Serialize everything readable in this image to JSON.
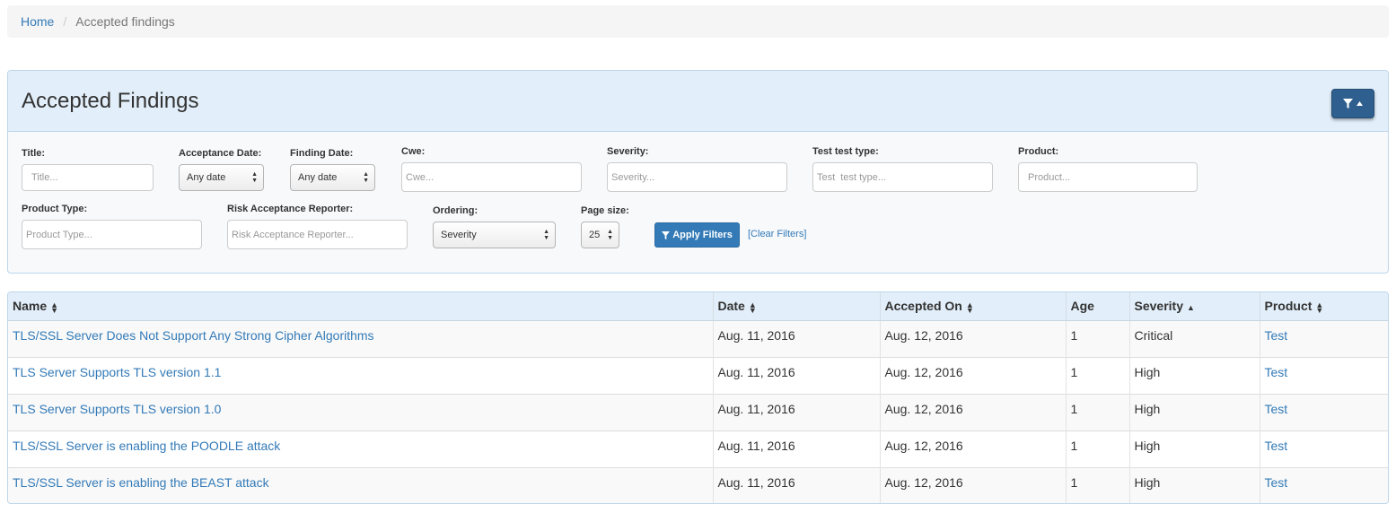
{
  "breadcrumb": {
    "home": "Home",
    "current": "Accepted findings"
  },
  "panel": {
    "title": "Accepted Findings"
  },
  "filters": {
    "title": {
      "label": "Title:",
      "placeholder": "Title..."
    },
    "acceptance_date": {
      "label": "Acceptance Date:",
      "value": "Any date"
    },
    "finding_date": {
      "label": "Finding Date:",
      "value": "Any date"
    },
    "cwe": {
      "label": "Cwe:",
      "placeholder": "Cwe..."
    },
    "severity": {
      "label": "Severity:",
      "placeholder": "Severity..."
    },
    "test_type": {
      "label": "Test test type:",
      "placeholder": "Test  test type..."
    },
    "product": {
      "label": "Product:",
      "placeholder": "Product..."
    },
    "product_type": {
      "label": "Product Type:",
      "placeholder": "Product Type..."
    },
    "reporter": {
      "label": "Risk Acceptance Reporter:",
      "placeholder": "Risk Acceptance Reporter..."
    },
    "ordering": {
      "label": "Ordering:",
      "value": "Severity"
    },
    "page_size": {
      "label": "Page size:",
      "value": "25"
    },
    "apply_label": "Apply Filters",
    "clear_label": "[Clear Filters]"
  },
  "table": {
    "columns": [
      "Name",
      "Date",
      "Accepted On",
      "Age",
      "Severity",
      "Product"
    ],
    "rows": [
      {
        "name": "TLS/SSL Server Does Not Support Any Strong Cipher Algorithms",
        "date": "Aug. 11, 2016",
        "accepted_on": "Aug. 12, 2016",
        "age": "1",
        "severity": "Critical",
        "product": "Test"
      },
      {
        "name": "TLS Server Supports TLS version 1.1",
        "date": "Aug. 11, 2016",
        "accepted_on": "Aug. 12, 2016",
        "age": "1",
        "severity": "High",
        "product": "Test"
      },
      {
        "name": "TLS Server Supports TLS version 1.0",
        "date": "Aug. 11, 2016",
        "accepted_on": "Aug. 12, 2016",
        "age": "1",
        "severity": "High",
        "product": "Test"
      },
      {
        "name": "TLS/SSL Server is enabling the POODLE attack",
        "date": "Aug. 11, 2016",
        "accepted_on": "Aug. 12, 2016",
        "age": "1",
        "severity": "High",
        "product": "Test"
      },
      {
        "name": "TLS/SSL Server is enabling the BEAST attack",
        "date": "Aug. 11, 2016",
        "accepted_on": "Aug. 12, 2016",
        "age": "1",
        "severity": "High",
        "product": "Test"
      }
    ]
  },
  "colors": {
    "link": "#337ab7",
    "panel_heading": "#e2eef9",
    "toggle_button": "#2f5f8e",
    "apply_button": "#337ab7"
  },
  "icons": {
    "filter": "filter-icon",
    "caret_up": "caret-up-icon",
    "sort_both": "sort-icon",
    "sort_asc": "sort-asc-icon"
  }
}
